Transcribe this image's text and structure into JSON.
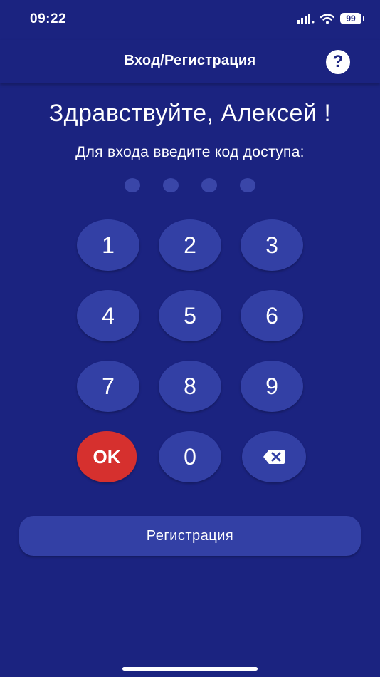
{
  "status_bar": {
    "time": "09:22",
    "battery": "99",
    "icons": [
      "signal-icon",
      "wifi-icon",
      "battery-icon"
    ]
  },
  "nav": {
    "title": "Вход/Регистрация",
    "help_label": "?"
  },
  "main": {
    "greeting": "Здравствуйте, Алексей !",
    "prompt": "Для входа введите код доступа:",
    "pin_length": 4,
    "pin_entered": 0
  },
  "keypad": {
    "k1": "1",
    "k2": "2",
    "k3": "3",
    "k4": "4",
    "k5": "5",
    "k6": "6",
    "k7": "7",
    "k8": "8",
    "k9": "9",
    "ok": "OK",
    "k0": "0",
    "backspace_icon": "backspace-icon"
  },
  "register_label": "Регистрация",
  "colors": {
    "background": "#1b2380",
    "key": "#3340a5",
    "ok_key": "#d6302e",
    "dot": "#3a46a8"
  }
}
